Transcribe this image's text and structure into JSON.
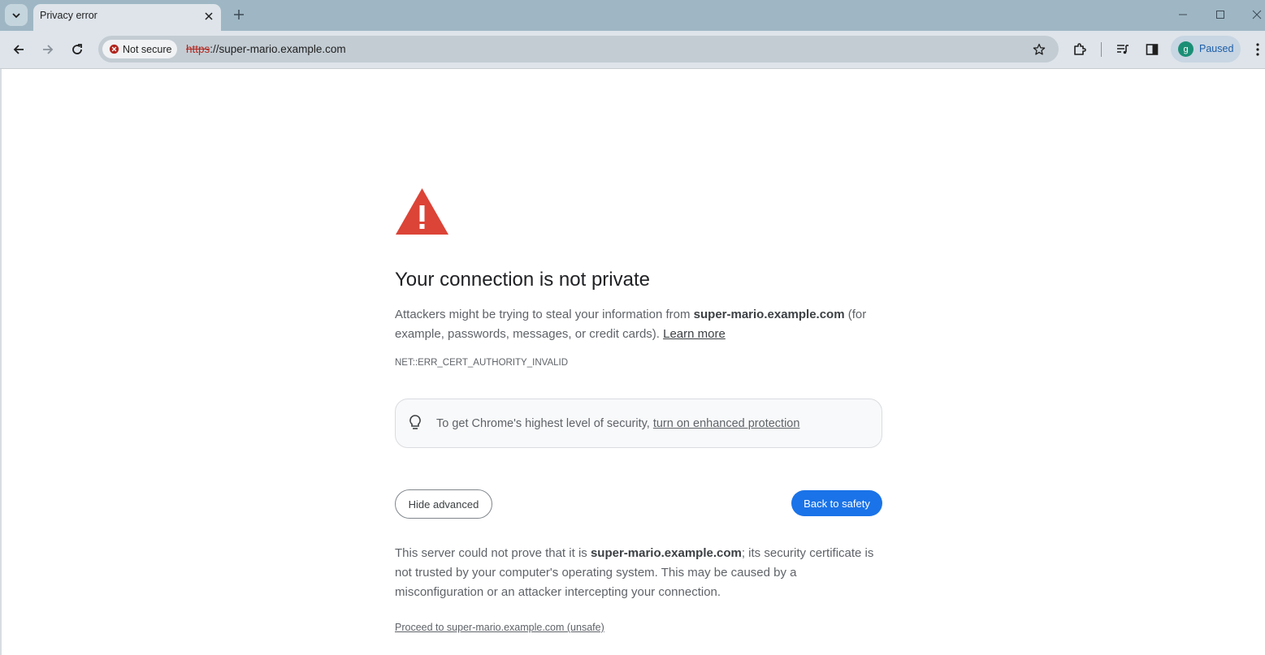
{
  "browser": {
    "tab_title": "Privacy error",
    "security_chip": "Not secure",
    "url_scheme": "https",
    "url_rest": "://super-mario.example.com",
    "profile_initial": "g",
    "profile_label": "Paused",
    "accent_color": "#1a73e8",
    "danger_color": "#b3261e"
  },
  "page": {
    "heading": "Your connection is not private",
    "intro_before": "Attackers might be trying to steal your information from ",
    "intro_domain": "super-mario.example.com",
    "intro_after": " (for example, passwords, messages, or credit cards). ",
    "learn_more": "Learn more",
    "error_code": "NET::ERR_CERT_AUTHORITY_INVALID",
    "tip_text": "To get Chrome's highest level of security, ",
    "tip_link": "turn on enhanced protection",
    "hide_advanced": "Hide advanced",
    "back_to_safety": "Back to safety",
    "details_before": "This server could not prove that it is ",
    "details_domain": "super-mario.example.com",
    "details_after": "; its security certificate is not trusted by your computer's operating system. This may be caused by a misconfiguration or an attacker intercepting your connection.",
    "proceed_link": "Proceed to super-mario.example.com (unsafe)"
  },
  "icons": {
    "warning": "warning-triangle-icon",
    "tip": "lightbulb-icon"
  }
}
